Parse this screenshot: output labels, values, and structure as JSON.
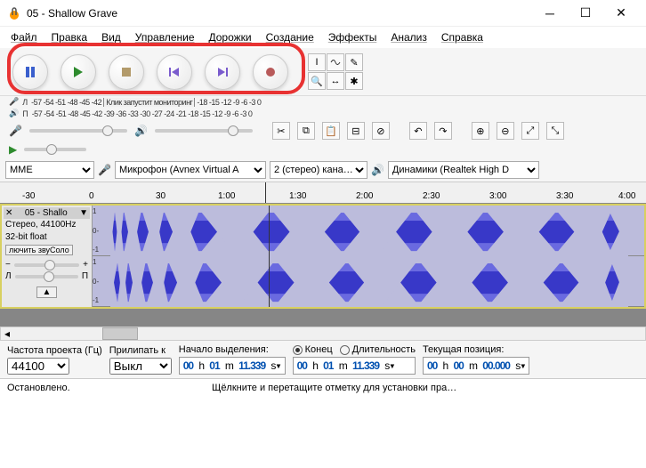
{
  "window": {
    "title": "05 - Shallow Grave"
  },
  "menu": {
    "file": "Файл",
    "edit": "Правка",
    "view": "Вид",
    "manage": "Управление",
    "tracks": "Дорожки",
    "create": "Создание",
    "effects": "Эффекты",
    "analyze": "Анализ",
    "help": "Справка"
  },
  "meter": {
    "rec_ticks": "-57 -54 -51 -48 -45 -42",
    "rec_hint": "Клик запустит мониторинг",
    "rec_ticks2": "-18 -15 -12 -9 -6 -3 0",
    "play_ticks": "-57 -54 -51 -48 -45 -42 -39 -36 -33 -30 -27 -24 -21 -18 -15 -12 -9 -6 -3 0",
    "L": "Л",
    "R": "П"
  },
  "meter_labels": {
    "L": "Л",
    "R": "П"
  },
  "devices": {
    "host": "MME",
    "input": "Микрофон (Avnex Virtual A",
    "channels": "2 (стерео) кана…",
    "output": "Динамики (Realtek High D"
  },
  "ruler": {
    "t0": "-30",
    "t1": "0",
    "t2": "30",
    "t3": "1:00",
    "t4": "1:30",
    "t5": "2:00",
    "t6": "2:30",
    "t7": "3:00",
    "t8": "3:30",
    "t9": "4:00"
  },
  "track": {
    "name": "05 - Shallo",
    "format_line1": "Стерео, 44100Hz",
    "format_line2": "32-bit float",
    "mute_solo": "лючить звуСоло",
    "scale_top": "1",
    "scale_mid": "0-",
    "scale_bot": "-1"
  },
  "status": {
    "rate_label": "Частота проекта (Гц)",
    "rate_value": "44100",
    "snap_label": "Прилипать к",
    "snap_value": "Выкл",
    "sel_start_label": "Начало выделения:",
    "sel_end_label": "Конец",
    "sel_len_label": "Длительность",
    "pos_label": "Текущая позиция:",
    "stopped": "Остановлено.",
    "hint": "Щёлкните и перетащите отметку для установки пра…"
  },
  "time": {
    "sel_start_h": "00",
    "sel_start_m": "01",
    "sel_start_s": "11.339",
    "unit_h": "h",
    "unit_m": "m",
    "unit_s": "s",
    "sel_end_h": "00",
    "sel_end_m": "01",
    "sel_end_s": "11.339",
    "pos_h": "00",
    "pos_m": "00",
    "pos_s": "00.000"
  }
}
